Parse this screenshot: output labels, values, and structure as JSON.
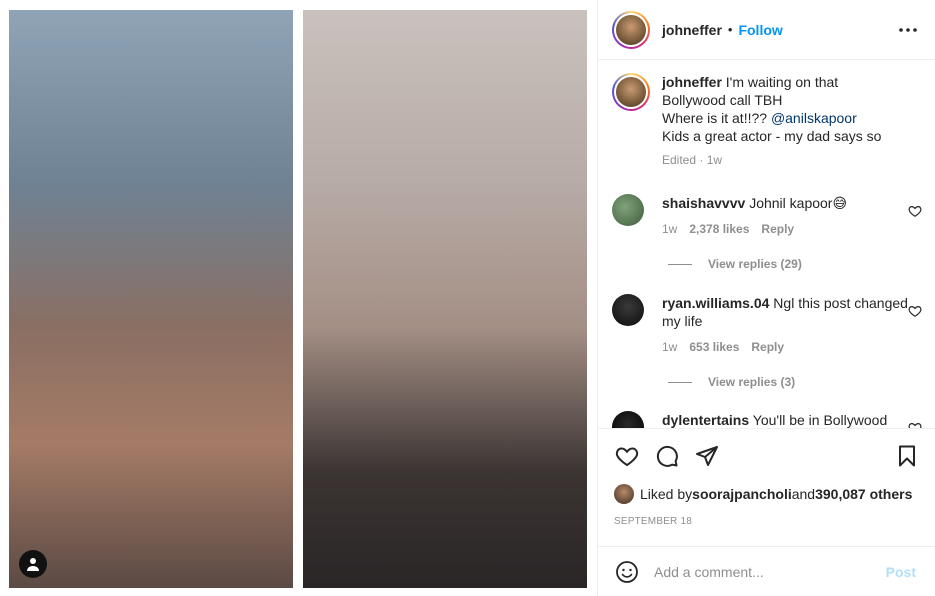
{
  "post": {
    "author": "johneffer",
    "follow_label": "Follow",
    "dot": "•",
    "more_icon": "more-horizontal-icon"
  },
  "caption": {
    "username": "johneffer",
    "line1": "I'm waiting on that",
    "line2": "Bollywood call TBH",
    "line3_prefix": "Where is it at!!?? ",
    "mention": "@anilskapoor",
    "line4": "Kids a great actor - my dad says so",
    "meta": "Edited · 1w"
  },
  "comments": [
    {
      "username": "shaishavvvv",
      "text": "Johnil kapoor😅",
      "time": "1w",
      "likes": "2,378 likes",
      "reply_label": "Reply",
      "view_replies": "View replies (29)"
    },
    {
      "username": "ryan.williams.04",
      "text": "Ngl this post changed my life",
      "time": "1w",
      "likes": "653 likes",
      "reply_label": "Reply",
      "view_replies": "View replies (3)"
    },
    {
      "username": "dylentertains",
      "text": "You'll be in Bollywood"
    }
  ],
  "likes": {
    "prefix": "Liked by ",
    "user": "soorajpancholi",
    "middle": " and ",
    "count": "390,087 others"
  },
  "date": "SEPTEMBER 18",
  "add_comment": {
    "placeholder": "Add a comment...",
    "post_label": "Post"
  },
  "colors": {
    "accent": "#0095f6",
    "post_disabled": "#b2dffc",
    "mention": "#00376b"
  }
}
